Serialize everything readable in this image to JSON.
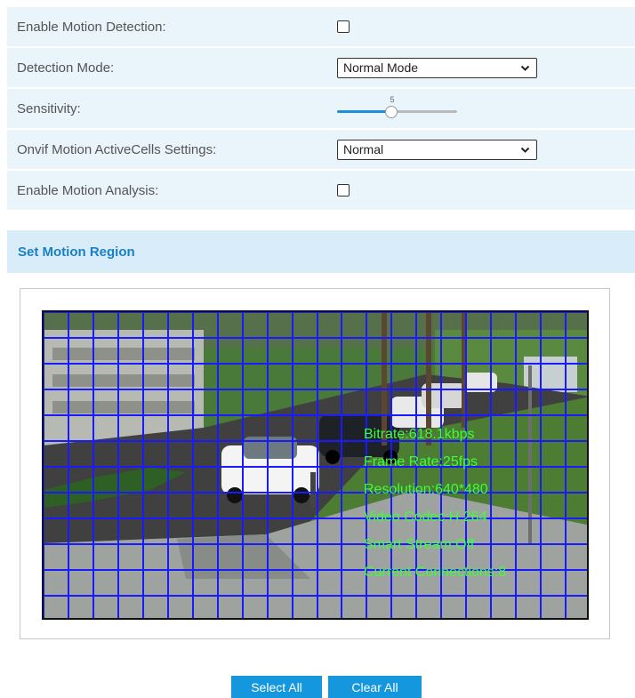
{
  "settings": {
    "enable_motion_detection": {
      "label": "Enable Motion Detection:",
      "checked": false
    },
    "detection_mode": {
      "label": "Detection Mode:",
      "value": "Normal Mode"
    },
    "sensitivity": {
      "label": "Sensitivity:",
      "value": 5,
      "max": 10
    },
    "onvif_activecells": {
      "label": "Onvif Motion ActiveCells Settings:",
      "value": "Normal"
    },
    "enable_motion_analysis": {
      "label": "Enable Motion Analysis:",
      "checked": false
    }
  },
  "motion_region": {
    "title": "Set Motion Region",
    "osd": {
      "bitrate": "Bitrate:618.1kbps",
      "frame_rate": "Frame Rate:25fps",
      "resolution": "Resolution:640*480",
      "video_codec": "Video Codec:H.264",
      "smart_stream": "Smart Stream:Off",
      "connections": "Current Connections:8"
    },
    "grid": {
      "columns": 22,
      "rows": 12
    }
  },
  "buttons": {
    "select_all": "Select All",
    "clear_all": "Clear All"
  },
  "colors": {
    "accent": "#1597dd",
    "row_alt": "#e9f4fb",
    "header_bg": "#d8ecf9",
    "header_text": "#1a7fc6",
    "grid_line": "#1a1aff",
    "osd_text": "#3cff3c"
  },
  "icons": {
    "select_arrow": "chevron-down-icon"
  }
}
